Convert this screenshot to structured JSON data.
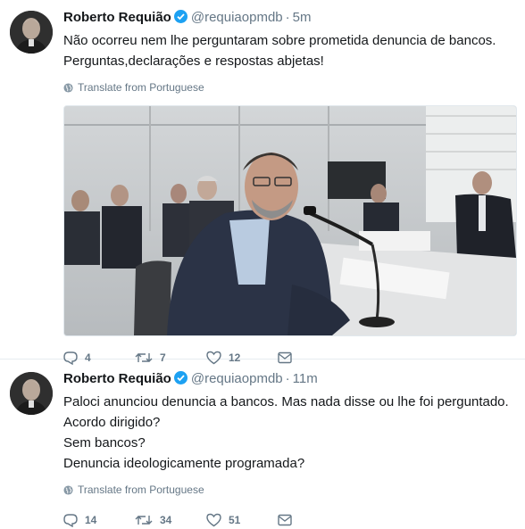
{
  "tweets": [
    {
      "name": "Roberto Requião",
      "handle": "@requiaopmdb",
      "separator": "·",
      "time": "5m",
      "text_lines": [
        "Não ocorreu nem lhe perguntaram sobre prometida denuncia de bancos.",
        "Perguntas,declarações e respostas abjetas!"
      ],
      "translate": "Translate from Portuguese",
      "replies": "4",
      "retweets": "7",
      "likes": "12"
    },
    {
      "name": "Roberto Requião",
      "handle": "@requiaopmdb",
      "separator": "·",
      "time": "11m",
      "text_lines": [
        "Paloci anunciou denuncia a bancos. Mas nada disse ou lhe foi perguntado.",
        "Acordo dirigido?",
        "Sem bancos?",
        "Denuncia ideologicamente programada?"
      ],
      "translate": "Translate from Portuguese",
      "replies": "14",
      "retweets": "34",
      "likes": "51"
    }
  ],
  "icons": {
    "verified": "verified-badge-icon",
    "globe": "globe-icon",
    "reply": "reply-icon",
    "retweet": "retweet-icon",
    "like": "heart-icon",
    "message": "envelope-icon"
  },
  "colors": {
    "verified": "#1da1f2",
    "secondary_text": "#657786",
    "primary_text": "#14171a",
    "divider": "#e6ecf0"
  }
}
